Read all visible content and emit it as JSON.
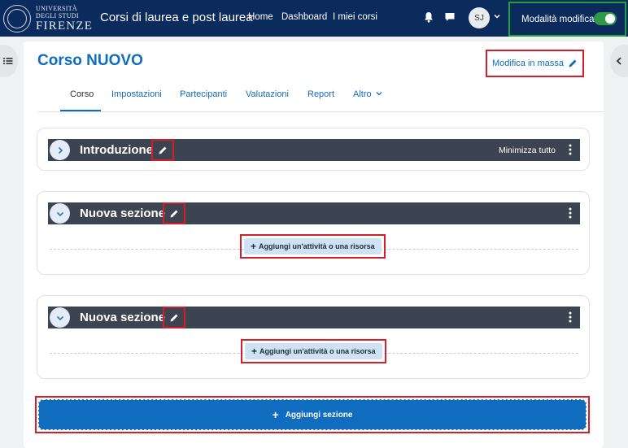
{
  "header": {
    "university_lines": [
      "UNIVERSITÀ",
      "DEGLI STUDI",
      "FIRENZE"
    ],
    "site_title": "Corsi di laurea e post laurea",
    "nav": [
      "Home",
      "Dashboard",
      "I miei corsi"
    ],
    "user_initials": "SJ",
    "edit_mode_label": "Modalità modifica",
    "edit_mode_on": true
  },
  "course": {
    "title": "Corso NUOVO",
    "bulk_edit_label": "Modifica in massa",
    "tabs": [
      "Corso",
      "Impostazioni",
      "Partecipanti",
      "Valutazioni",
      "Report",
      "Altro"
    ],
    "active_tab": "Corso"
  },
  "sections": [
    {
      "title": "Introduzione",
      "collapse_all_label": "Minimizza tutto"
    },
    {
      "title": "Nuova sezione",
      "add_activity_label": "Aggiungi un'attività o una risorsa"
    },
    {
      "title": "Nuova sezione",
      "add_activity_label": "Aggiungi un'attività o una risorsa"
    }
  ],
  "add_section_label": "Aggiungi sezione",
  "colors": {
    "navbar": "#0a2b5c",
    "primary": "#0f6cbf",
    "highlight_red": "#d41f2a",
    "highlight_green": "#1fa33b",
    "section_bar": "#3d4451"
  }
}
